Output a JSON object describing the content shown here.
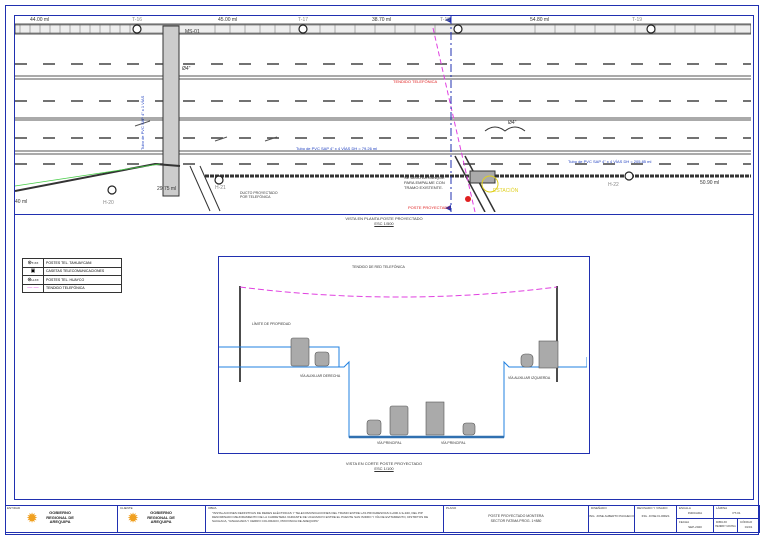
{
  "plan": {
    "dimensions": [
      "44.00 ml",
      "45.00 ml",
      "38.70 ml",
      "54.80 ml",
      "29.75 ml",
      "50.90 ml",
      "40 ml"
    ],
    "poles_t": [
      "T-16",
      "T-17",
      "T-18",
      "T-19"
    ],
    "poles_h": [
      "H-20",
      "H-21",
      "H-22"
    ],
    "pole_tag": "MS-01",
    "diam_1": "Ø4\"",
    "diam_2": "Ø4\"",
    "conduit_vertical": "Tubo de PVC SAP 4\" x 1 VÍAS",
    "conduit_left": "Tubo de PVC SAP 4\" x 4 VÍAS  DH = 79.26 ml",
    "conduit_right": "Tubo de PVC SAP 4\" x 4 VÍAS  DH = 205.85 ml",
    "tendido_label": "TENDIDO TELEFÓNICA",
    "anclaje_label": "SE DEJÓ ARRANQUE PARA EMPALME CON TRAMO EXISTENTE.",
    "poste_label": "POSTE PROYECTADO",
    "ducto_label": "DUCTO PROYECTADO POR TELEFÓNICA",
    "station_label": "ESTACIÓN",
    "title": "VISTA EN PLANTA POSTE PROYECTADO",
    "scale": "ESC 1/500"
  },
  "legend": [
    {
      "symbol": "⊛",
      "code": "T-XX",
      "label": "POSTES TEL. TAHUAYCANI"
    },
    {
      "symbol": "▣",
      "code": "",
      "label": "CASETAS TELECOMUNICACIONES"
    },
    {
      "symbol": "⊛",
      "code": "H-XX",
      "label": "POSTES TEL. HUAYCO"
    },
    {
      "symbol": "— —",
      "code": "",
      "label": "TENDIDO TELEFÓNICA"
    }
  ],
  "section": {
    "cable_label": "TENDIDO DE RED TELEFÓNICA",
    "property_label": "LÍMITE DE PROPIEDAD",
    "aux_right": "VÍA AUXILIAR DERECHA",
    "aux_left": "VÍA AUXILIAR IZQUIERDA",
    "main_1": "VÍA PRINCIPAL",
    "main_2": "VÍA PRINCIPAL",
    "title": "VISTA EN CORTE POSTE PROYECTADO",
    "scale": "ESC 1/100"
  },
  "title_block": {
    "entity_caption": "ENTIDAD",
    "entity_name": "GOBIERNO REGIONAL DE AREQUIPA",
    "owner_caption": "CLIENTE",
    "owner_name": "GOBIERNO REGIONAL DE AREQUIPA",
    "project_caption": "OBRA",
    "project_text": "\"INSTALACIONES DEFINITIVAS DE REDES ELÉCTRICAS Y TELECOMUNICACIONES DEL TRAMO ENTRE LAS PROGRESIVAS 0+000 A 3+940, DEL PIP DENOMINADO MEJORAMIENTO DE LA CARRETERA VARIANTE DE UCHUMAYO ENTRE EL PUENTE SAN ISIDRO Y VÍA DE EVITAMIENTO, DISTRITOS DE SACHACA, YANAHUARA Y CERRO COLORADO, PROVINCIA DE AREQUIPA\"",
    "plan_caption": "PLANO",
    "plan_text": "POSTE PROYECTADO MONTERA  SECTOR FATIMA  PROG. 1+880",
    "designer_caption": "DISEÑADO",
    "designer": "ING. JOSE ALBERTO PACHECO",
    "reviewer_caption": "REVISADO Y VISADO",
    "reviewer": "ING. JOSE FLORES",
    "scale_caption": "ESCALA",
    "scale": "INDICADA",
    "date_caption": "FECHA",
    "date": "SEP-2020",
    "sheet_caption": "LÁMINA",
    "sheet": "PT-01",
    "drawn_caption": "DIBUJO",
    "drawn": "HENRRY URVINA",
    "code_caption": "CÓDIGO",
    "code": "01/01"
  }
}
